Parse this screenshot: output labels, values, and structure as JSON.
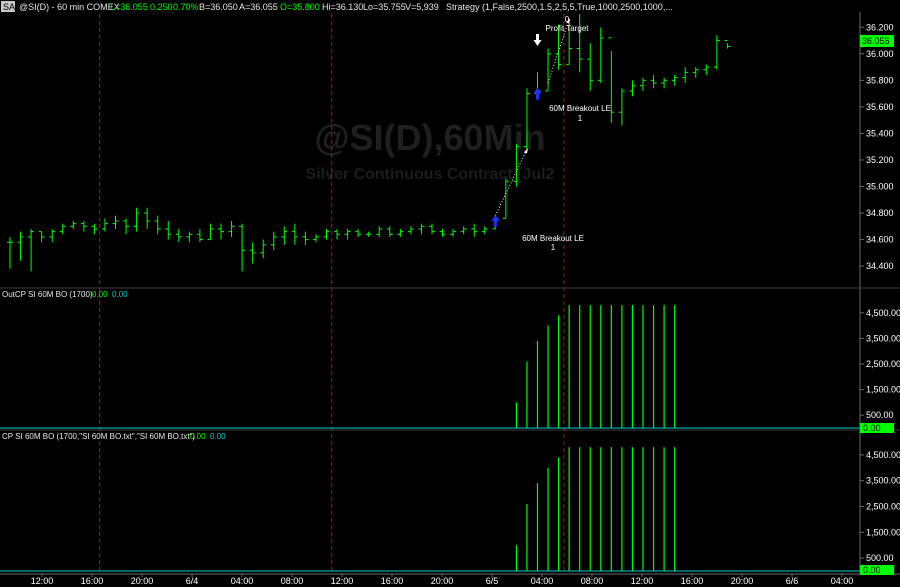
{
  "header": {
    "badge": "SA",
    "symbol": "@SI(D) - 60 min  COMEX",
    "last": "L=36.055",
    "chg": "0.250",
    "pct": "0.70%",
    "bid": "B=36.050",
    "ask": "A=36.055",
    "open": "O=35.800",
    "high": "Hi=36.130",
    "low": "Lo=35.755",
    "vol": "V=5,939",
    "strategy": "Strategy (1,False,2500,1.5,2,5,5,True,1000,2500,1000,..."
  },
  "watermark": {
    "title": "@SI(D),60Min",
    "subtitle": "Silver Continuous Contract [Jul2"
  },
  "colors": {
    "background": "#000000",
    "up_bar": "#00ff00",
    "grid_red": "#b01818",
    "axis": "#6a6a6a",
    "entry_arrow": "#2030ff",
    "cyan": "#00cccc"
  },
  "last_price_tag": "36.055",
  "annotations": {
    "profit_target_count": "0",
    "profit_target": "Profit Target",
    "entry1_label": "60M Breakout LE",
    "entry1_count": "1",
    "entry2_label": "60M Breakout LE",
    "entry2_count": "1"
  },
  "panels": {
    "ind1": {
      "name": "OutCP SI 60M BO (1700)",
      "v1": "0.00",
      "v2": "0.00",
      "tag": "0.00"
    },
    "ind2": {
      "name": "CP SI 60M BO (1700,\"SI 60M BO.txt\",\"SI 60M BO.txt\")",
      "v1": "0.00",
      "v2": "0.00",
      "tag": "0.00"
    }
  },
  "chart_data": {
    "type": "bar",
    "price_axis": {
      "ylim": [
        34.25,
        36.3
      ],
      "ticks": [
        "36.200",
        "36.000",
        "35.800",
        "35.600",
        "35.400",
        "35.200",
        "35.000",
        "34.800",
        "34.600",
        "34.400"
      ]
    },
    "indicator_axis": {
      "ylim": [
        0,
        5000
      ],
      "ticks": [
        "4,500.00",
        "3,500.00",
        "2,500.00",
        "1,500.00",
        "500.00"
      ]
    },
    "x_ticks": [
      "12:00",
      "16:00",
      "20:00",
      "6/4",
      "04:00",
      "08:00",
      "12:00",
      "16:00",
      "20:00",
      "6/5",
      "04:00",
      "08:00",
      "12:00",
      "16:00",
      "20:00",
      "6/6",
      "04:00"
    ],
    "session_breaks": [
      8,
      30,
      52
    ],
    "ohlc": [
      {
        "o": 34.58,
        "h": 34.62,
        "l": 34.38,
        "c": 34.58
      },
      {
        "o": 34.58,
        "h": 34.66,
        "l": 34.44,
        "c": 34.62
      },
      {
        "o": 34.62,
        "h": 34.68,
        "l": 34.36,
        "c": 34.66
      },
      {
        "o": 34.66,
        "h": 34.66,
        "l": 34.58,
        "c": 34.62
      },
      {
        "o": 34.62,
        "h": 34.68,
        "l": 34.58,
        "c": 34.66
      },
      {
        "o": 34.66,
        "h": 34.72,
        "l": 34.64,
        "c": 34.7
      },
      {
        "o": 34.7,
        "h": 34.74,
        "l": 34.68,
        "c": 34.72
      },
      {
        "o": 34.72,
        "h": 34.74,
        "l": 34.66,
        "c": 34.7
      },
      {
        "o": 34.7,
        "h": 34.72,
        "l": 34.64,
        "c": 34.68
      },
      {
        "o": 34.68,
        "h": 34.76,
        "l": 34.66,
        "c": 34.72
      },
      {
        "o": 34.72,
        "h": 34.78,
        "l": 34.68,
        "c": 34.74
      },
      {
        "o": 34.74,
        "h": 34.76,
        "l": 34.64,
        "c": 34.7
      },
      {
        "o": 34.7,
        "h": 34.84,
        "l": 34.66,
        "c": 34.8
      },
      {
        "o": 34.8,
        "h": 34.84,
        "l": 34.68,
        "c": 34.74
      },
      {
        "o": 34.74,
        "h": 34.78,
        "l": 34.64,
        "c": 34.68
      },
      {
        "o": 34.68,
        "h": 34.74,
        "l": 34.6,
        "c": 34.64
      },
      {
        "o": 34.64,
        "h": 34.68,
        "l": 34.58,
        "c": 34.62
      },
      {
        "o": 34.62,
        "h": 34.66,
        "l": 34.58,
        "c": 34.64
      },
      {
        "o": 34.64,
        "h": 34.68,
        "l": 34.58,
        "c": 34.6
      },
      {
        "o": 34.6,
        "h": 34.72,
        "l": 34.6,
        "c": 34.68
      },
      {
        "o": 34.68,
        "h": 34.72,
        "l": 34.6,
        "c": 34.66
      },
      {
        "o": 34.66,
        "h": 34.74,
        "l": 34.62,
        "c": 34.7
      },
      {
        "o": 34.7,
        "h": 34.72,
        "l": 34.36,
        "c": 34.52
      },
      {
        "o": 34.52,
        "h": 34.58,
        "l": 34.42,
        "c": 34.5
      },
      {
        "o": 34.5,
        "h": 34.6,
        "l": 34.46,
        "c": 34.56
      },
      {
        "o": 34.56,
        "h": 34.66,
        "l": 34.52,
        "c": 34.62
      },
      {
        "o": 34.62,
        "h": 34.7,
        "l": 34.56,
        "c": 34.66
      },
      {
        "o": 34.66,
        "h": 34.72,
        "l": 34.56,
        "c": 34.62
      },
      {
        "o": 34.62,
        "h": 34.66,
        "l": 34.56,
        "c": 34.6
      },
      {
        "o": 34.6,
        "h": 34.64,
        "l": 34.58,
        "c": 34.62
      },
      {
        "o": 34.62,
        "h": 34.68,
        "l": 34.6,
        "c": 34.66
      },
      {
        "o": 34.66,
        "h": 34.68,
        "l": 34.6,
        "c": 34.64
      },
      {
        "o": 34.64,
        "h": 34.68,
        "l": 34.6,
        "c": 34.66
      },
      {
        "o": 34.66,
        "h": 34.68,
        "l": 34.62,
        "c": 34.64
      },
      {
        "o": 34.64,
        "h": 34.66,
        "l": 34.62,
        "c": 34.64
      },
      {
        "o": 34.64,
        "h": 34.7,
        "l": 34.62,
        "c": 34.68
      },
      {
        "o": 34.68,
        "h": 34.7,
        "l": 34.62,
        "c": 34.64
      },
      {
        "o": 34.64,
        "h": 34.68,
        "l": 34.62,
        "c": 34.66
      },
      {
        "o": 34.66,
        "h": 34.7,
        "l": 34.64,
        "c": 34.68
      },
      {
        "o": 34.68,
        "h": 34.72,
        "l": 34.64,
        "c": 34.7
      },
      {
        "o": 34.7,
        "h": 34.72,
        "l": 34.64,
        "c": 34.66
      },
      {
        "o": 34.66,
        "h": 34.68,
        "l": 34.62,
        "c": 34.64
      },
      {
        "o": 34.64,
        "h": 34.68,
        "l": 34.62,
        "c": 34.66
      },
      {
        "o": 34.66,
        "h": 34.7,
        "l": 34.64,
        "c": 34.68
      },
      {
        "o": 34.68,
        "h": 34.72,
        "l": 34.62,
        "c": 34.66
      },
      {
        "o": 34.66,
        "h": 34.7,
        "l": 34.64,
        "c": 34.68
      },
      {
        "o": 34.68,
        "h": 34.78,
        "l": 34.68,
        "c": 34.76
      },
      {
        "o": 34.76,
        "h": 35.06,
        "l": 34.76,
        "c": 35.04
      },
      {
        "o": 35.04,
        "h": 35.32,
        "l": 35.0,
        "c": 35.3
      },
      {
        "o": 35.3,
        "h": 35.74,
        "l": 35.28,
        "c": 35.7
      },
      {
        "o": 35.7,
        "h": 35.86,
        "l": 35.66,
        "c": 35.72
      },
      {
        "o": 35.72,
        "h": 36.04,
        "l": 35.72,
        "c": 36.0
      },
      {
        "o": 36.0,
        "h": 36.22,
        "l": 35.88,
        "c": 35.92
      },
      {
        "o": 35.92,
        "h": 36.26,
        "l": 35.92,
        "c": 36.04
      },
      {
        "o": 36.04,
        "h": 36.3,
        "l": 35.86,
        "c": 35.96
      },
      {
        "o": 35.96,
        "h": 36.08,
        "l": 35.72,
        "c": 35.8
      },
      {
        "o": 35.8,
        "h": 36.2,
        "l": 35.78,
        "c": 36.12
      },
      {
        "o": 36.12,
        "h": 36.02,
        "l": 35.48,
        "c": 35.56
      },
      {
        "o": 35.56,
        "h": 35.74,
        "l": 35.46,
        "c": 35.72
      },
      {
        "o": 35.72,
        "h": 35.8,
        "l": 35.68,
        "c": 35.76
      },
      {
        "o": 35.76,
        "h": 35.82,
        "l": 35.72,
        "c": 35.8
      },
      {
        "o": 35.8,
        "h": 35.84,
        "l": 35.74,
        "c": 35.78
      },
      {
        "o": 35.78,
        "h": 35.82,
        "l": 35.74,
        "c": 35.8
      },
      {
        "o": 35.8,
        "h": 35.84,
        "l": 35.76,
        "c": 35.82
      },
      {
        "o": 35.82,
        "h": 35.9,
        "l": 35.78,
        "c": 35.86
      },
      {
        "o": 35.86,
        "h": 35.9,
        "l": 35.82,
        "c": 35.88
      },
      {
        "o": 35.88,
        "h": 35.92,
        "l": 35.84,
        "c": 35.9
      },
      {
        "o": 35.9,
        "h": 36.14,
        "l": 35.88,
        "c": 36.1
      },
      {
        "o": 36.1,
        "h": 36.08,
        "l": 36.04,
        "c": 36.055
      }
    ],
    "entries": [
      {
        "bar": 46,
        "price": 34.74,
        "label_ref": "entry2"
      },
      {
        "bar": 50,
        "price": 35.7,
        "label_ref": "entry1"
      }
    ],
    "profit_target": {
      "bar": 50,
      "price": 36.0
    },
    "trend_lines": [
      {
        "from": [
          46,
          34.78
        ],
        "to": [
          49,
          35.28
        ]
      },
      {
        "from": [
          51,
          35.78
        ],
        "to": [
          53,
          36.26
        ]
      }
    ],
    "indicator_series": [
      {
        "values": [
          0,
          0,
          0,
          0,
          0,
          0,
          0,
          0,
          0,
          0,
          0,
          0,
          0,
          0,
          0,
          0,
          0,
          0,
          0,
          0,
          0,
          0,
          0,
          0,
          0,
          0,
          0,
          0,
          0,
          0,
          0,
          0,
          0,
          0,
          0,
          0,
          0,
          0,
          0,
          0,
          0,
          0,
          0,
          0,
          0,
          0,
          0,
          0,
          1000,
          2600,
          3400,
          4000,
          4400,
          4800,
          4800,
          4800,
          4800,
          4800,
          4800,
          4800,
          4800,
          4800,
          4800,
          4800,
          0,
          0,
          0,
          0,
          0,
          0,
          0
        ]
      },
      {
        "values": [
          0,
          0,
          0,
          0,
          0,
          0,
          0,
          0,
          0,
          0,
          0,
          0,
          0,
          0,
          0,
          0,
          0,
          0,
          0,
          0,
          0,
          0,
          0,
          0,
          0,
          0,
          0,
          0,
          0,
          0,
          0,
          0,
          0,
          0,
          0,
          0,
          0,
          0,
          0,
          0,
          0,
          0,
          0,
          0,
          0,
          0,
          0,
          0,
          1000,
          2600,
          3400,
          4000,
          4400,
          4800,
          4800,
          4800,
          4800,
          4800,
          4800,
          4800,
          4800,
          4800,
          4800,
          4800,
          0,
          0,
          0,
          0,
          0,
          0,
          0
        ]
      }
    ]
  }
}
